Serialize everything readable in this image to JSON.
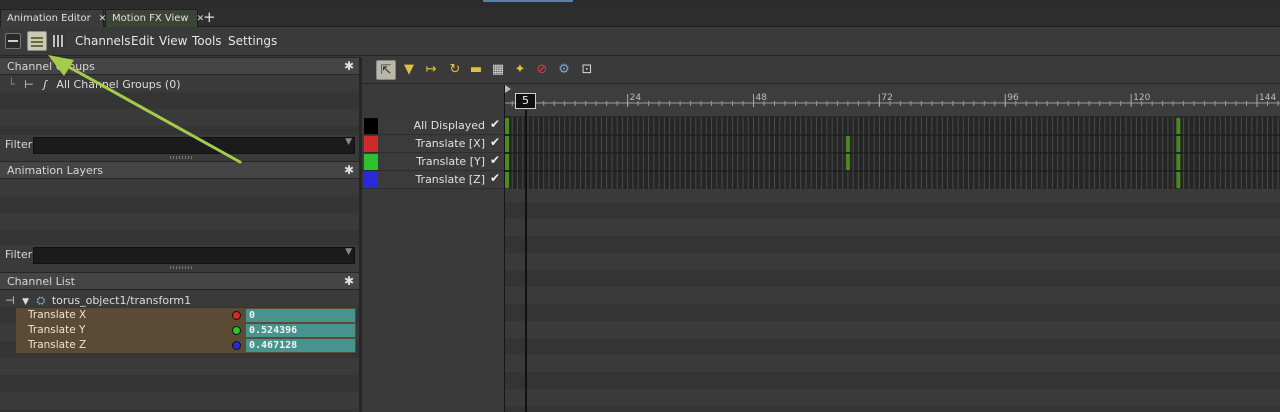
{
  "tabs": [
    {
      "label": "Animation Editor",
      "close": "✕"
    },
    {
      "label": "Motion FX View",
      "close": "✕"
    }
  ],
  "add_tab": "+",
  "menu": [
    "Channels",
    "Edit",
    "View",
    "Tools",
    "Settings"
  ],
  "channel_groups": {
    "title": "Channel Groups",
    "item": "All Channel Groups (0)",
    "filter_label": "Filter"
  },
  "animation_layers": {
    "title": "Animation Layers",
    "filter_label": "Filter"
  },
  "channel_list": {
    "title": "Channel List",
    "root": "torus_object1/transform1",
    "channels": [
      {
        "name": "Translate X",
        "value": "0",
        "color": "#d02a2a"
      },
      {
        "name": "Translate Y",
        "value": "0.524396",
        "color": "#2ec22e"
      },
      {
        "name": "Translate Z",
        "value": "0.467128",
        "color": "#2a2ad8"
      }
    ]
  },
  "dopesheet": {
    "rows": [
      {
        "label": "All Displayed",
        "color": "#000000"
      },
      {
        "label": "Translate [X]",
        "color": "#d02a2a"
      },
      {
        "label": "Translate [Y]",
        "color": "#2ec22e"
      },
      {
        "label": "Translate [Z]",
        "color": "#2a2ad8"
      }
    ],
    "ruler_ticks": [
      "24",
      "48",
      "72",
      "96",
      "120",
      "144"
    ],
    "ruler_range": [
      1,
      148
    ],
    "current_frame": "5",
    "keyframes": [
      1,
      66,
      129
    ],
    "key_color": "#4a8a1e"
  },
  "accent": "#a4cc4a"
}
